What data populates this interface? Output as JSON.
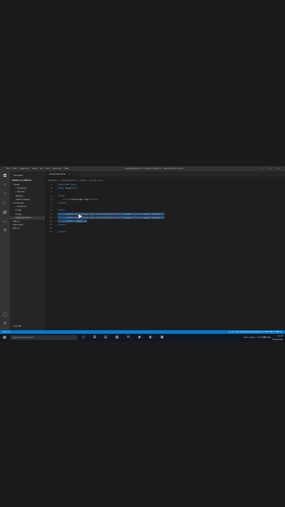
{
  "window": {
    "menu": [
      "File",
      "Edit",
      "Selection",
      "View",
      "Go",
      "Run",
      "Terminal",
      "Help"
    ],
    "title": "paragraph.html - Image_to_Sketch - Visual Studio Code",
    "controls": "— ▢ ✕"
  },
  "sidebar": {
    "header": "EXPLORER",
    "folder": "IMAGE_TO_SKETCH",
    "items": [
      {
        "label": "∨ static",
        "indent": 2
      },
      {
        "label": "› download",
        "indent": 4
      },
      {
        "label": "› uploads",
        "indent": 4
      },
      {
        "label": "bg.jpeg",
        "indent": 4
      },
      {
        "label": "upload_bg.png",
        "indent": 4
      },
      {
        "label": "∨ template",
        "indent": 2
      },
      {
        "label": "› collection",
        "indent": 4
      },
      {
        "label": "t1.jpg",
        "indent": 4
      },
      {
        "label": "t2.jpg",
        "indent": 4
      },
      {
        "label": "paragraph.html",
        "indent": 4,
        "selected": true
      },
      {
        "label": "app.py",
        "indent": 2
      },
      {
        "label": "demo.html",
        "indent": 2
      },
      {
        "label": "test.py",
        "indent": 2
      }
    ],
    "outline": "› OUTLINE"
  },
  "editor": {
    "tab": "paragraph.html",
    "breadcrumb": "template > ◇ paragraph.html > ◈ html > ◈ body > ◈ a",
    "lines": [
      {
        "n": "1",
        "parts": [
          [
            "tag",
            "<!DOCTYPE html>"
          ]
        ]
      },
      {
        "n": "2",
        "parts": [
          [
            "tag",
            "<html "
          ],
          [
            "attr",
            "lang"
          ],
          [
            "txt",
            "="
          ],
          [
            "str",
            "\"en\""
          ],
          [
            "tag",
            ">"
          ]
        ]
      },
      {
        "n": "3",
        "parts": []
      },
      {
        "n": "4",
        "parts": [
          [
            "tag",
            "<head>"
          ]
        ]
      },
      {
        "n": "5",
        "parts": [
          [
            "txt",
            "    "
          ],
          [
            "tag",
            "<title>"
          ],
          [
            "txt",
            "Paragraph Tag"
          ],
          [
            "tag",
            "</title>"
          ]
        ]
      },
      {
        "n": "6",
        "parts": [
          [
            "tag",
            "</head>"
          ]
        ]
      },
      {
        "n": "7",
        "parts": []
      },
      {
        "n": "8",
        "parts": [
          [
            "tag",
            "<body>"
          ]
        ]
      },
      {
        "n": "9",
        "hl": true,
        "parts": [
          [
            "txt",
            "    "
          ],
          [
            "tag",
            "<a "
          ],
          [
            "attr",
            "href"
          ],
          [
            "txt",
            "="
          ],
          [
            "str",
            "\"www.youtube.com/c/LearnCodingOfficial\""
          ],
          [
            "txt",
            " "
          ],
          [
            "attr",
            "target"
          ],
          [
            "txt",
            "="
          ],
          [
            "str",
            "\"_blank\""
          ],
          [
            "tag",
            ">"
          ],
          [
            "txt",
            "Learn Coding"
          ],
          [
            "tag",
            "</a>"
          ]
        ]
      },
      {
        "n": "10",
        "hl": true,
        "parts": [
          [
            "txt",
            "    "
          ],
          [
            "tag",
            "<a "
          ],
          [
            "attr",
            "href"
          ],
          [
            "txt",
            "="
          ],
          [
            "str",
            "\"www.youtube.com/c/LearnCodingOfficial\""
          ],
          [
            "txt",
            " "
          ],
          [
            "attr",
            "target"
          ],
          [
            "txt",
            "="
          ],
          [
            "str",
            "\"_blank\""
          ],
          [
            "tag",
            ">"
          ],
          [
            "txt",
            "Learn Coding"
          ],
          [
            "tag",
            "</a>"
          ]
        ]
      },
      {
        "n": "11",
        "hl": true,
        "parts": [
          [
            "txt",
            "    "
          ],
          [
            "tag",
            "<a "
          ],
          [
            "attr",
            "href"
          ],
          [
            "txt",
            "="
          ],
          [
            "str",
            "\"\""
          ],
          [
            "tag",
            ">"
          ],
          [
            "txt",
            "Home"
          ],
          [
            "tag",
            "</a>"
          ]
        ]
      },
      {
        "n": "12",
        "parts": [
          [
            "tag",
            "</body>"
          ]
        ]
      },
      {
        "n": "13",
        "parts": []
      },
      {
        "n": "14",
        "parts": [
          [
            "tag",
            "</html>"
          ]
        ]
      }
    ]
  },
  "statusbar": {
    "left": "⊗ 0 ⚠ 0",
    "right": "Ln 11, Col 16 (86 selected)   Spaces: 4   UTF-8   CRLF   HTML   ☺"
  },
  "taskbar": {
    "search": "Type here to search",
    "apps": "○ ⧉ ▤ ▦ ✉ ◉ ◐ ▣",
    "tray": "25°C Haze  ^  ✉ ☰ ⌨ ENG",
    "time": "11:18",
    "date": "25-06-2022"
  }
}
